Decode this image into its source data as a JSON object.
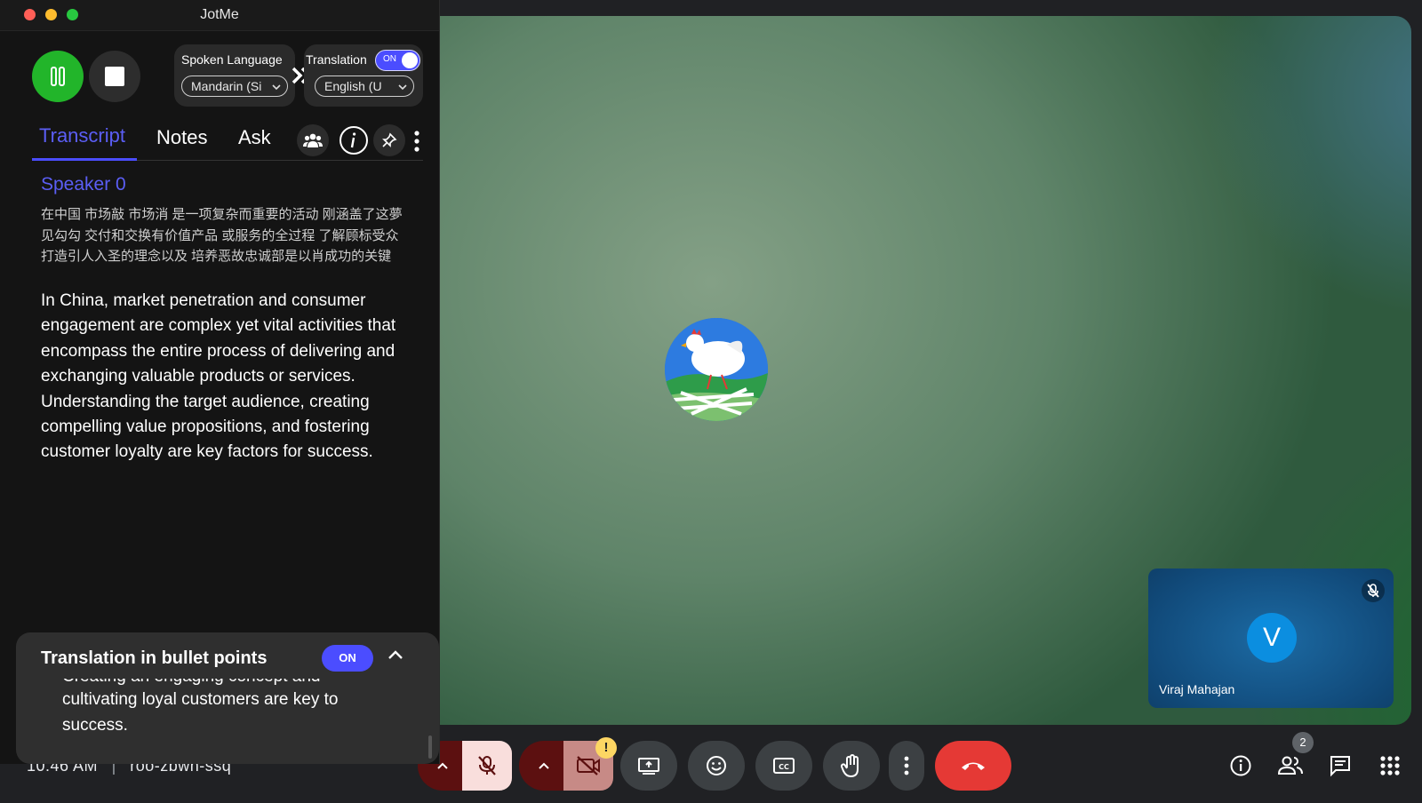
{
  "app": {
    "title": "JotMe"
  },
  "controls": {
    "spoken_language_label": "Spoken Language",
    "spoken_language_value": "Mandarin (Si",
    "translation_label": "Translation",
    "translation_toggle": "ON",
    "target_language_value": "English (U"
  },
  "tabs": [
    "Transcript",
    "Notes",
    "Ask"
  ],
  "transcript": {
    "speaker": "Speaker 0",
    "original": "在中国 市场敲 市场消 是一项复杂而重要的活动 刚涵盖了这夢见勾勾 交付和交换有价值产品 或服务的全过程 了解顾标受众 打造引人入圣的理念以及 培养恶故忠诚部是以肖成功的关键",
    "translation": "In China, market penetration and consumer engagement are complex yet vital activities that encompass the entire process of delivering and exchanging valuable products or services. Understanding the target audience, creating compelling value propositions, and fostering customer loyalty are key factors for success."
  },
  "bullet_panel": {
    "title": "Translation in bullet points",
    "toggle": "ON",
    "partial_line": "Creating an engaging concept and",
    "text": "cultivating loyal customers are key to success."
  },
  "meeting": {
    "time": "10:46 AM",
    "separator": "|",
    "code": "roo-zbwn-ssq",
    "self_initial": "V",
    "self_name": "Viraj Mahajan",
    "participants_count": "2",
    "camera_warning": "!"
  },
  "colors": {
    "accent": "#4b4dff",
    "pause_green": "#22b52a",
    "end_call_red": "#e53935"
  },
  "icons": [
    "pause-icon",
    "stop-icon",
    "people-icon",
    "info-icon",
    "pin-icon",
    "more-icon",
    "mic-off-icon",
    "camera-off-icon",
    "present-icon",
    "emoji-icon",
    "captions-icon",
    "raise-hand-icon",
    "end-call-icon",
    "participants-icon",
    "chat-icon",
    "activities-icon"
  ]
}
